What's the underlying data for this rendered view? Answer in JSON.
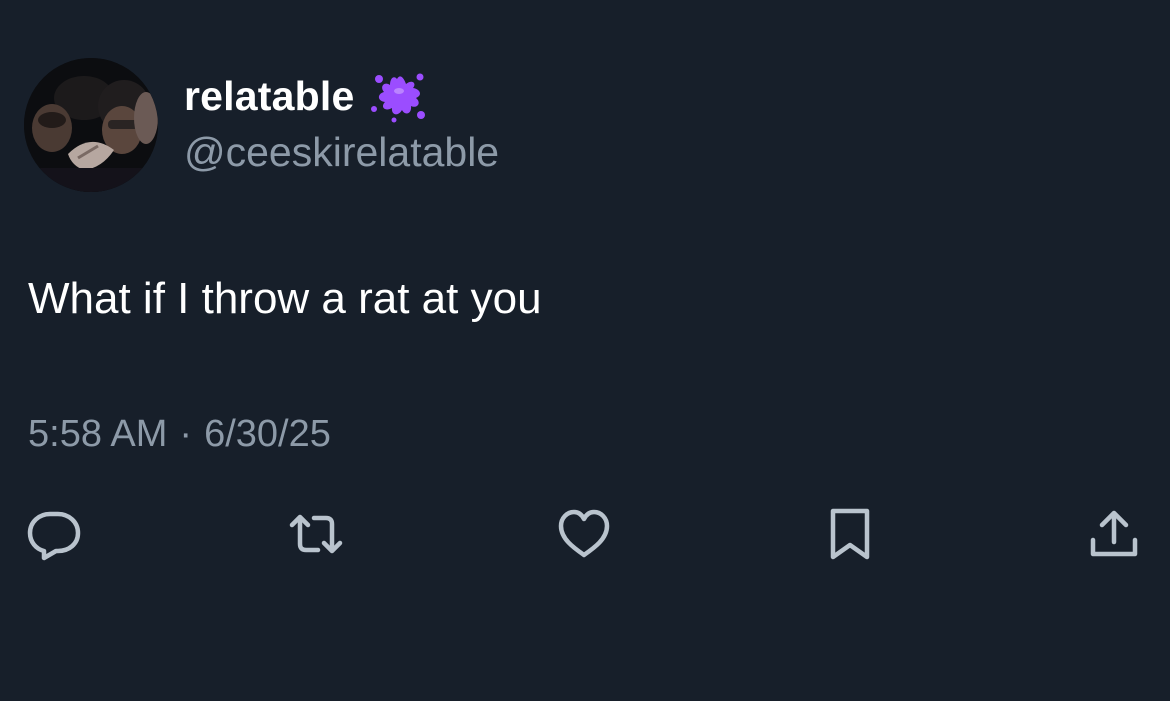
{
  "author": {
    "display_name": "relatable",
    "handle": "@ceeskirelatable",
    "badge_icon": "purple-splat-emoji"
  },
  "tweet": {
    "text": "What if I throw a rat at you",
    "time": "5:58 AM",
    "separator": "·",
    "date": "6/30/25"
  },
  "actions": {
    "reply_icon": "speech-bubble-icon",
    "retweet_icon": "retweet-icon",
    "like_icon": "heart-icon",
    "bookmark_icon": "bookmark-icon",
    "share_icon": "share-upload-icon"
  },
  "colors": {
    "background": "#171f2a",
    "primary_text": "#ffffff",
    "secondary_text": "#8d9aa8",
    "icon": "#b9c3cd",
    "badge": "#9b4dff"
  }
}
